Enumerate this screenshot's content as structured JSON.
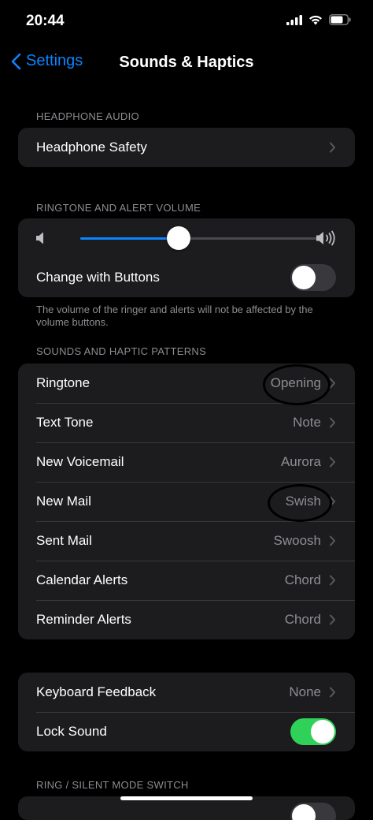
{
  "status": {
    "time": "20:44",
    "battery_level": 0.75
  },
  "nav": {
    "back_label": "Settings",
    "title": "Sounds & Haptics"
  },
  "headphone_section": {
    "header": "HEADPHONE AUDIO",
    "safety_label": "Headphone Safety"
  },
  "volume_section": {
    "header": "RINGTONE AND ALERT VOLUME",
    "volume_level": 0.41,
    "change_with_buttons_label": "Change with Buttons",
    "change_with_buttons_on": false,
    "footer": "The volume of the ringer and alerts will not be affected by the volume buttons."
  },
  "patterns_section": {
    "header": "SOUNDS AND HAPTIC PATTERNS",
    "items": [
      {
        "label": "Ringtone",
        "value": "Opening",
        "circled": true
      },
      {
        "label": "Text Tone",
        "value": "Note"
      },
      {
        "label": "New Voicemail",
        "value": "Aurora"
      },
      {
        "label": "New Mail",
        "value": "Swish",
        "circled": true
      },
      {
        "label": "Sent Mail",
        "value": "Swoosh"
      },
      {
        "label": "Calendar Alerts",
        "value": "Chord"
      },
      {
        "label": "Reminder Alerts",
        "value": "Chord"
      }
    ]
  },
  "feedback_section": {
    "keyboard_feedback_label": "Keyboard Feedback",
    "keyboard_feedback_value": "None",
    "lock_sound_label": "Lock Sound",
    "lock_sound_on": true
  },
  "ring_silent_section": {
    "header": "RING / SILENT MODE SWITCH"
  },
  "colors": {
    "accent": "#0a84ff",
    "toggle_on": "#30d158",
    "cell_bg": "#1c1c1e",
    "secondary_text": "#8d8d93"
  }
}
